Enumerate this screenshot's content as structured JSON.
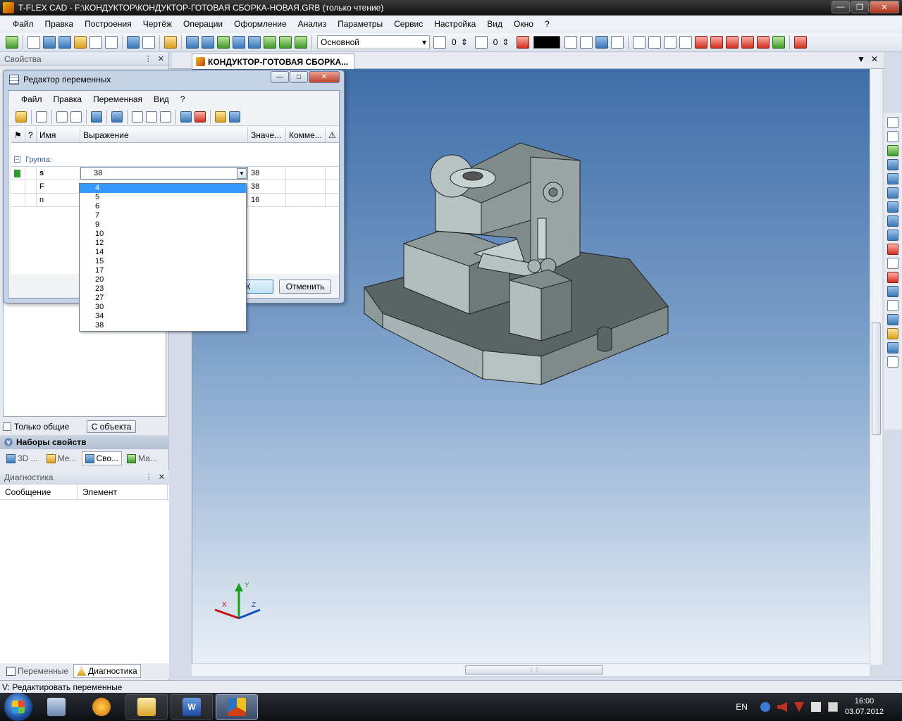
{
  "window": {
    "title": "T-FLEX CAD - F:\\КОНДУКТОР\\КОНДУКТОР-ГОТОВАЯ СБОРКА-НОВАЯ.GRB (только чтение)"
  },
  "menu": [
    "Файл",
    "Правка",
    "Построения",
    "Чертёж",
    "Операции",
    "Оформление",
    "Анализ",
    "Параметры",
    "Сервис",
    "Настройка",
    "Вид",
    "Окно",
    "?"
  ],
  "toolbar": {
    "layer_combo": "Основной",
    "level_value": "0",
    "priority_value": "0",
    "color_value": "#000000"
  },
  "properties_panel": {
    "title": "Свойства",
    "only_common_label": "Только общие",
    "from_object_button": "С объекта",
    "property_sets_title": "Наборы свойств",
    "tabs": [
      "3D ...",
      "Ме...",
      "Сво...",
      "Ма..."
    ]
  },
  "diagnostics_panel": {
    "title": "Диагностика",
    "columns": [
      "Сообщение",
      "Элемент"
    ]
  },
  "bottom_tabs": [
    "Переменные",
    "Диагностика"
  ],
  "document": {
    "tab_title": "КОНДУКТОР-ГОТОВАЯ СБОРКА..."
  },
  "axes": {
    "x": "X",
    "y": "Y",
    "z": "Z"
  },
  "variable_editor": {
    "title": "Редактор переменных",
    "menu": [
      "Файл",
      "Правка",
      "Переменная",
      "Вид",
      "?"
    ],
    "columns": {
      "question": "?",
      "name": "Имя",
      "expression": "Выражение",
      "value": "Значе...",
      "comment": "Комме..."
    },
    "group_label": "Группа:",
    "rows": [
      {
        "name": "s",
        "expression": "38",
        "value": "38"
      },
      {
        "name": "F",
        "expression": "",
        "value": "38"
      },
      {
        "name": "n",
        "expression": "",
        "value": "16"
      }
    ],
    "ok_button": "К",
    "cancel_button": "Отменить",
    "dropdown_options": [
      "4",
      "5",
      "6",
      "7",
      "9",
      "10",
      "12",
      "14",
      "15",
      "17",
      "20",
      "23",
      "27",
      "30",
      "34",
      "38"
    ],
    "dropdown_selected": "4"
  },
  "status_bar": {
    "text": "V: Редактировать переменные"
  },
  "taskbar": {
    "language": "EN",
    "time": "16:00",
    "date": "03.07.2012"
  }
}
